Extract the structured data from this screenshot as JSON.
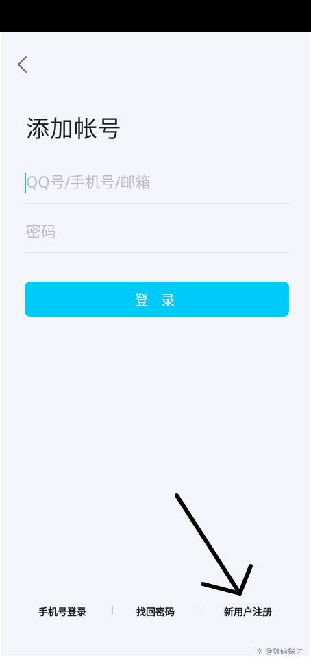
{
  "header": {
    "back_icon": "chevron-left-icon"
  },
  "page": {
    "title": "添加帐号"
  },
  "form": {
    "account_placeholder": "QQ号/手机号/邮箱",
    "password_placeholder": "密码",
    "login_label": "登 录"
  },
  "footer": {
    "phone_login": "手机号登录",
    "recover_password": "找回密码",
    "register": "新用户注册"
  },
  "watermark": {
    "text": "@数码探讨",
    "icon": "watermark-logo-icon"
  },
  "colors": {
    "accent": "#00caf7",
    "background": "#f3f5fb",
    "caret": "#12b7f5",
    "status_bar": "#000000"
  }
}
